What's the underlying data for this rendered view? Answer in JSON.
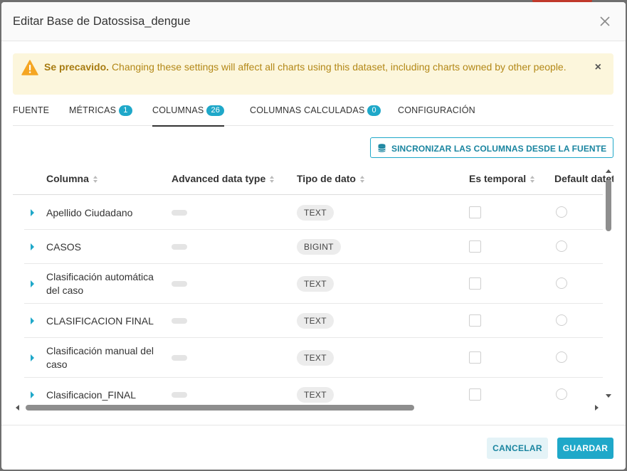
{
  "modal": {
    "title": "Editar Base de Datossisa_dengue"
  },
  "alert": {
    "title": "Se precavido.",
    "message": "Changing these settings will affect all charts using this dataset, including charts owned by other people."
  },
  "tabs": [
    {
      "label": "FUENTE",
      "badge": ""
    },
    {
      "label": "MÉTRICAS",
      "badge": "1"
    },
    {
      "label": "COLUMNAS",
      "badge": "26",
      "active": true
    },
    {
      "label": "COLUMNAS CALCULADAS",
      "badge": "0"
    },
    {
      "label": "CONFIGURACIÓN",
      "badge": ""
    }
  ],
  "sync_button": {
    "label": "SINCRONIZAR LAS COLUMNAS DESDE LA FUENTE"
  },
  "table": {
    "headers": [
      "Columna",
      "Advanced data type",
      "Tipo de dato",
      "Es temporal",
      "Default datetime"
    ],
    "rows": [
      {
        "name": "Apellido Ciudadano",
        "type": "TEXT"
      },
      {
        "name": "CASOS",
        "type": "BIGINT"
      },
      {
        "name": "Clasificación automática del caso",
        "type": "TEXT"
      },
      {
        "name": "CLASIFICACION FINAL",
        "type": "TEXT"
      },
      {
        "name": "Clasificación manual del caso",
        "type": "TEXT"
      },
      {
        "name": "Clasificacion_FINAL",
        "type": "TEXT"
      }
    ]
  },
  "footer": {
    "cancel_label": "CANCELAR",
    "save_label": "GUARDAR"
  },
  "colors": {
    "accent": "#1fa8c9",
    "warning_bg": "#fcf6dc",
    "warning_text": "#b38817"
  }
}
